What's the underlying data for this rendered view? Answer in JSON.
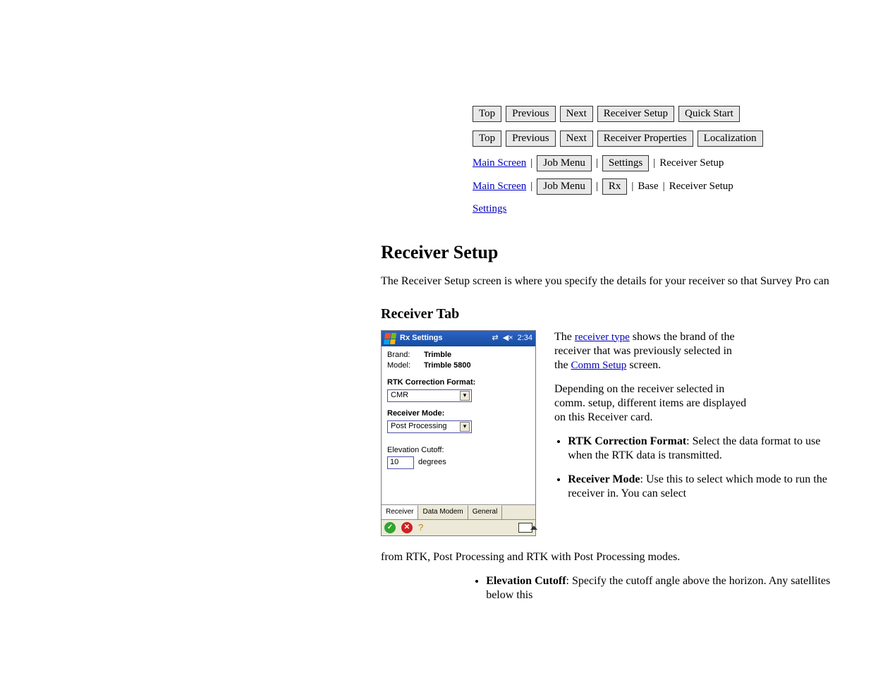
{
  "nav": {
    "row1": {
      "top": "Top",
      "prev": "Previous",
      "next": "Next",
      "receiver": "Receiver Setup",
      "quickstart": "Quick Start"
    },
    "row2": {
      "top": "Top",
      "prev": "Previous",
      "next": "Next",
      "receiver": "Receiver Properties",
      "localize": "Localization"
    }
  },
  "crumbs1": {
    "main": "Main Screen",
    "sep": "|",
    "job": "Job Menu",
    "sep2": "|",
    "settings": "Settings",
    "sep3": "|",
    "current": "Receiver Setup"
  },
  "crumbs2": {
    "main": "Main Screen",
    "sep": "|",
    "job": "Job Menu",
    "sep2": "|",
    "rx": "Rx",
    "sep3": "|",
    "base": "Base",
    "sep4": "|",
    "current": "Receiver Setup"
  },
  "settings_link": "Settings",
  "receiver_tab_head": "Receiver Tab",
  "device": {
    "title": "Rx Settings",
    "time": "2:34",
    "brand_k": "Brand:",
    "brand_v": "Trimble",
    "model_k": "Model:",
    "model_v": "Trimble 5800",
    "rtk_label": "RTK Correction Format:",
    "rtk_value": "CMR",
    "mode_label": "Receiver Mode:",
    "mode_value": "Post Processing",
    "cutoff_label": "Elevation Cutoff:",
    "cutoff_value": "10",
    "cutoff_units": "degrees",
    "tabs": {
      "receiver": "Receiver",
      "datamodem": "Data Modem",
      "general": "General"
    }
  },
  "right": {
    "l1a": "The ",
    "l1b": "receiver type",
    "l1c": " shows the brand of the",
    "l2": "receiver that was previously selected in",
    "l3a": "the ",
    "l3b": "Comm Setup",
    "l3c": " screen.",
    "para2l1": "Depending on the receiver selected in",
    "para2l2": "comm. setup, different items are displayed",
    "para2l3": "on this Receiver card.",
    "bullets": {
      "b1a": "RTK Correction Format",
      "b1b": ": Select the data format to use when the RTK data is transmitted.",
      "b2a": "Receiver Mode",
      "b2b": ": Use this to select which mode to run the receiver in. You can select"
    }
  },
  "bottom": {
    "li3a": "Elevation Cutoff",
    "li3b": ": Specify the cutoff angle above the horizon. Any satellites below this"
  }
}
